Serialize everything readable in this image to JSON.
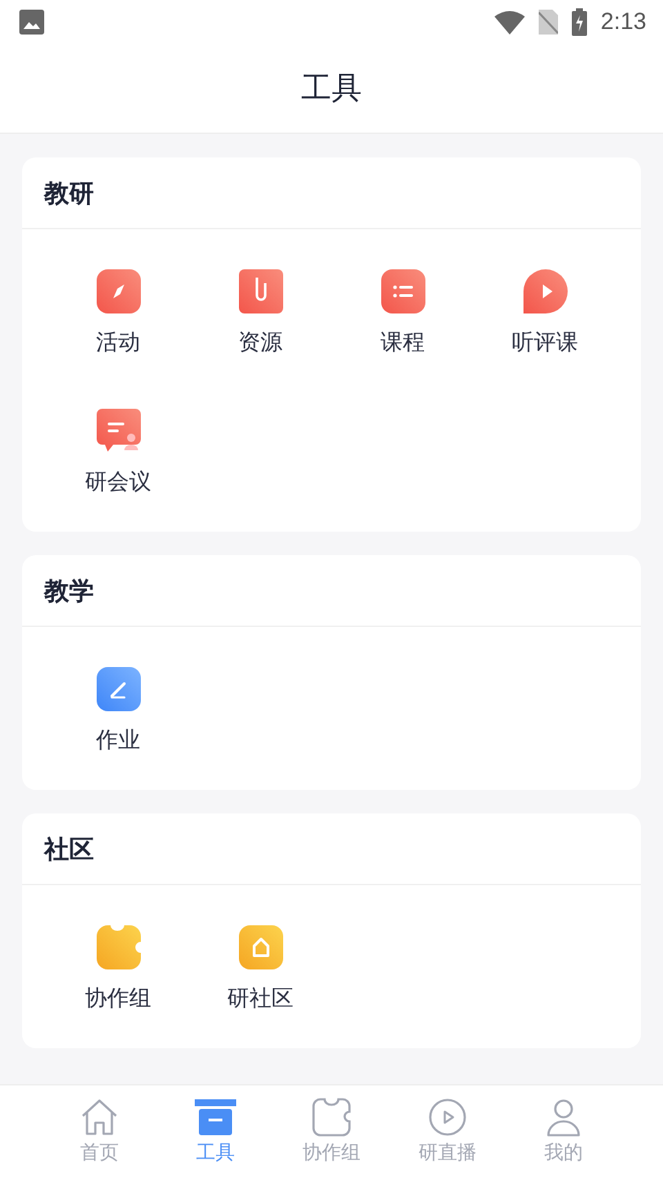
{
  "status_bar": {
    "time": "2:13"
  },
  "header": {
    "title": "工具"
  },
  "sections": [
    {
      "title": "教研",
      "items": [
        {
          "label": "活动"
        },
        {
          "label": "资源"
        },
        {
          "label": "课程"
        },
        {
          "label": "听评课"
        },
        {
          "label": "研会议"
        }
      ]
    },
    {
      "title": "教学",
      "items": [
        {
          "label": "作业"
        }
      ]
    },
    {
      "title": "社区",
      "items": [
        {
          "label": "协作组"
        },
        {
          "label": "研社区"
        }
      ]
    }
  ],
  "tab_bar": [
    {
      "label": "首页",
      "selected": false
    },
    {
      "label": "工具",
      "selected": true
    },
    {
      "label": "协作组",
      "selected": false
    },
    {
      "label": "研直播",
      "selected": false
    },
    {
      "label": "我的",
      "selected": false
    }
  ]
}
